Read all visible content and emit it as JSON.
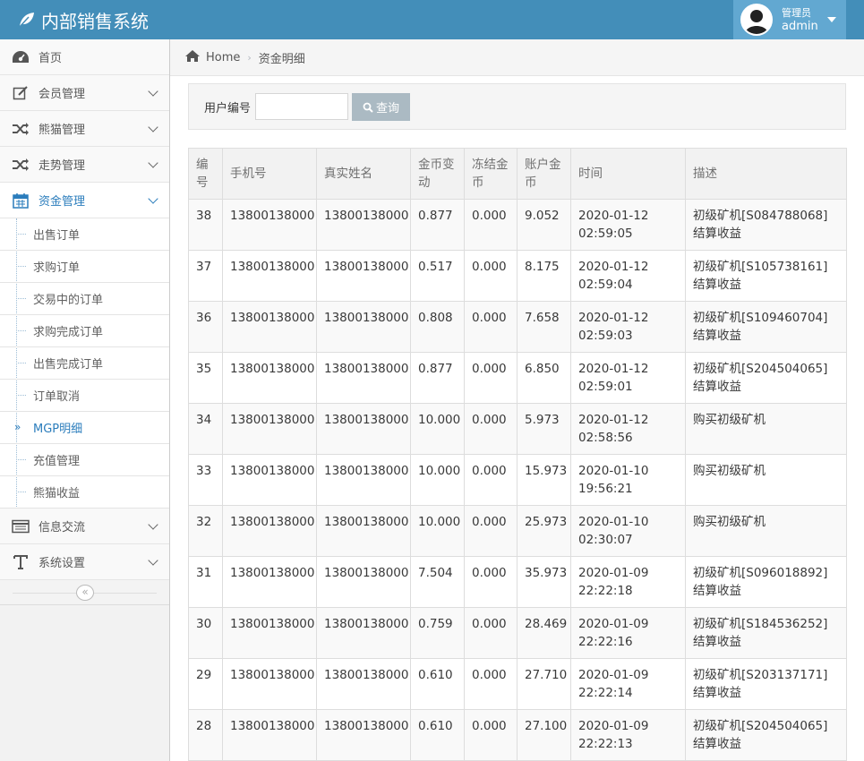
{
  "app": {
    "title": "内部销售系统"
  },
  "user": {
    "role": "管理员",
    "name": "admin"
  },
  "sidebar": {
    "items": [
      {
        "label": "首页",
        "icon": "dashboard-icon"
      },
      {
        "label": "会员管理",
        "icon": "edit-icon"
      },
      {
        "label": "熊猫管理",
        "icon": "random-icon"
      },
      {
        "label": "走势管理",
        "icon": "random-icon"
      },
      {
        "label": "资金管理",
        "icon": "calendar-icon"
      },
      {
        "label": "信息交流",
        "icon": "list-icon"
      },
      {
        "label": "系统设置",
        "icon": "text-icon"
      }
    ],
    "submenu": [
      "出售订单",
      "求购订单",
      "交易中的订单",
      "求购完成订单",
      "出售完成订单",
      "订单取消",
      "MGP明细",
      "充值管理",
      "熊猫收益"
    ],
    "collapse_label": "«"
  },
  "breadcrumb": {
    "home": "Home",
    "current": "资金明细"
  },
  "search": {
    "label": "用户编号",
    "value": "",
    "button": "查询"
  },
  "table": {
    "headers": [
      "编\n号",
      "手机号",
      "真实姓名",
      "金币变\n动",
      "冻结金\n币",
      "账户金\n币",
      "时间",
      "描述"
    ],
    "rows": [
      [
        "38",
        "13800138000",
        "13800138000",
        "0.877",
        "0.000",
        "9.052",
        "2020-01-12\n02:59:05",
        "初级矿机[S084788068]结算收益"
      ],
      [
        "37",
        "13800138000",
        "13800138000",
        "0.517",
        "0.000",
        "8.175",
        "2020-01-12\n02:59:04",
        "初级矿机[S105738161]结算收益"
      ],
      [
        "36",
        "13800138000",
        "13800138000",
        "0.808",
        "0.000",
        "7.658",
        "2020-01-12\n02:59:03",
        "初级矿机[S109460704]结算收益"
      ],
      [
        "35",
        "13800138000",
        "13800138000",
        "0.877",
        "0.000",
        "6.850",
        "2020-01-12\n02:59:01",
        "初级矿机[S204504065]结算收益"
      ],
      [
        "34",
        "13800138000",
        "13800138000",
        "10.000",
        "0.000",
        "5.973",
        "2020-01-12\n02:58:56",
        "购买初级矿机"
      ],
      [
        "33",
        "13800138000",
        "13800138000",
        "10.000",
        "0.000",
        "15.973",
        "2020-01-10\n19:56:21",
        "购买初级矿机"
      ],
      [
        "32",
        "13800138000",
        "13800138000",
        "10.000",
        "0.000",
        "25.973",
        "2020-01-10\n02:30:07",
        "购买初级矿机"
      ],
      [
        "31",
        "13800138000",
        "13800138000",
        "7.504",
        "0.000",
        "35.973",
        "2020-01-09\n22:22:18",
        "初级矿机[S096018892]结算收益"
      ],
      [
        "30",
        "13800138000",
        "13800138000",
        "0.759",
        "0.000",
        "28.469",
        "2020-01-09\n22:22:16",
        "初级矿机[S184536252]结算收益"
      ],
      [
        "29",
        "13800138000",
        "13800138000",
        "0.610",
        "0.000",
        "27.710",
        "2020-01-09\n22:22:14",
        "初级矿机[S203137171]结算收益"
      ],
      [
        "28",
        "13800138000",
        "13800138000",
        "0.610",
        "0.000",
        "27.100",
        "2020-01-09\n22:22:13",
        "初级矿机[S204504065]结算收益"
      ]
    ]
  },
  "colors": {
    "navbar": "#438eb9",
    "user_box": "#62a8d1",
    "accent": "#2b7dbc",
    "button": "#abbac3"
  }
}
